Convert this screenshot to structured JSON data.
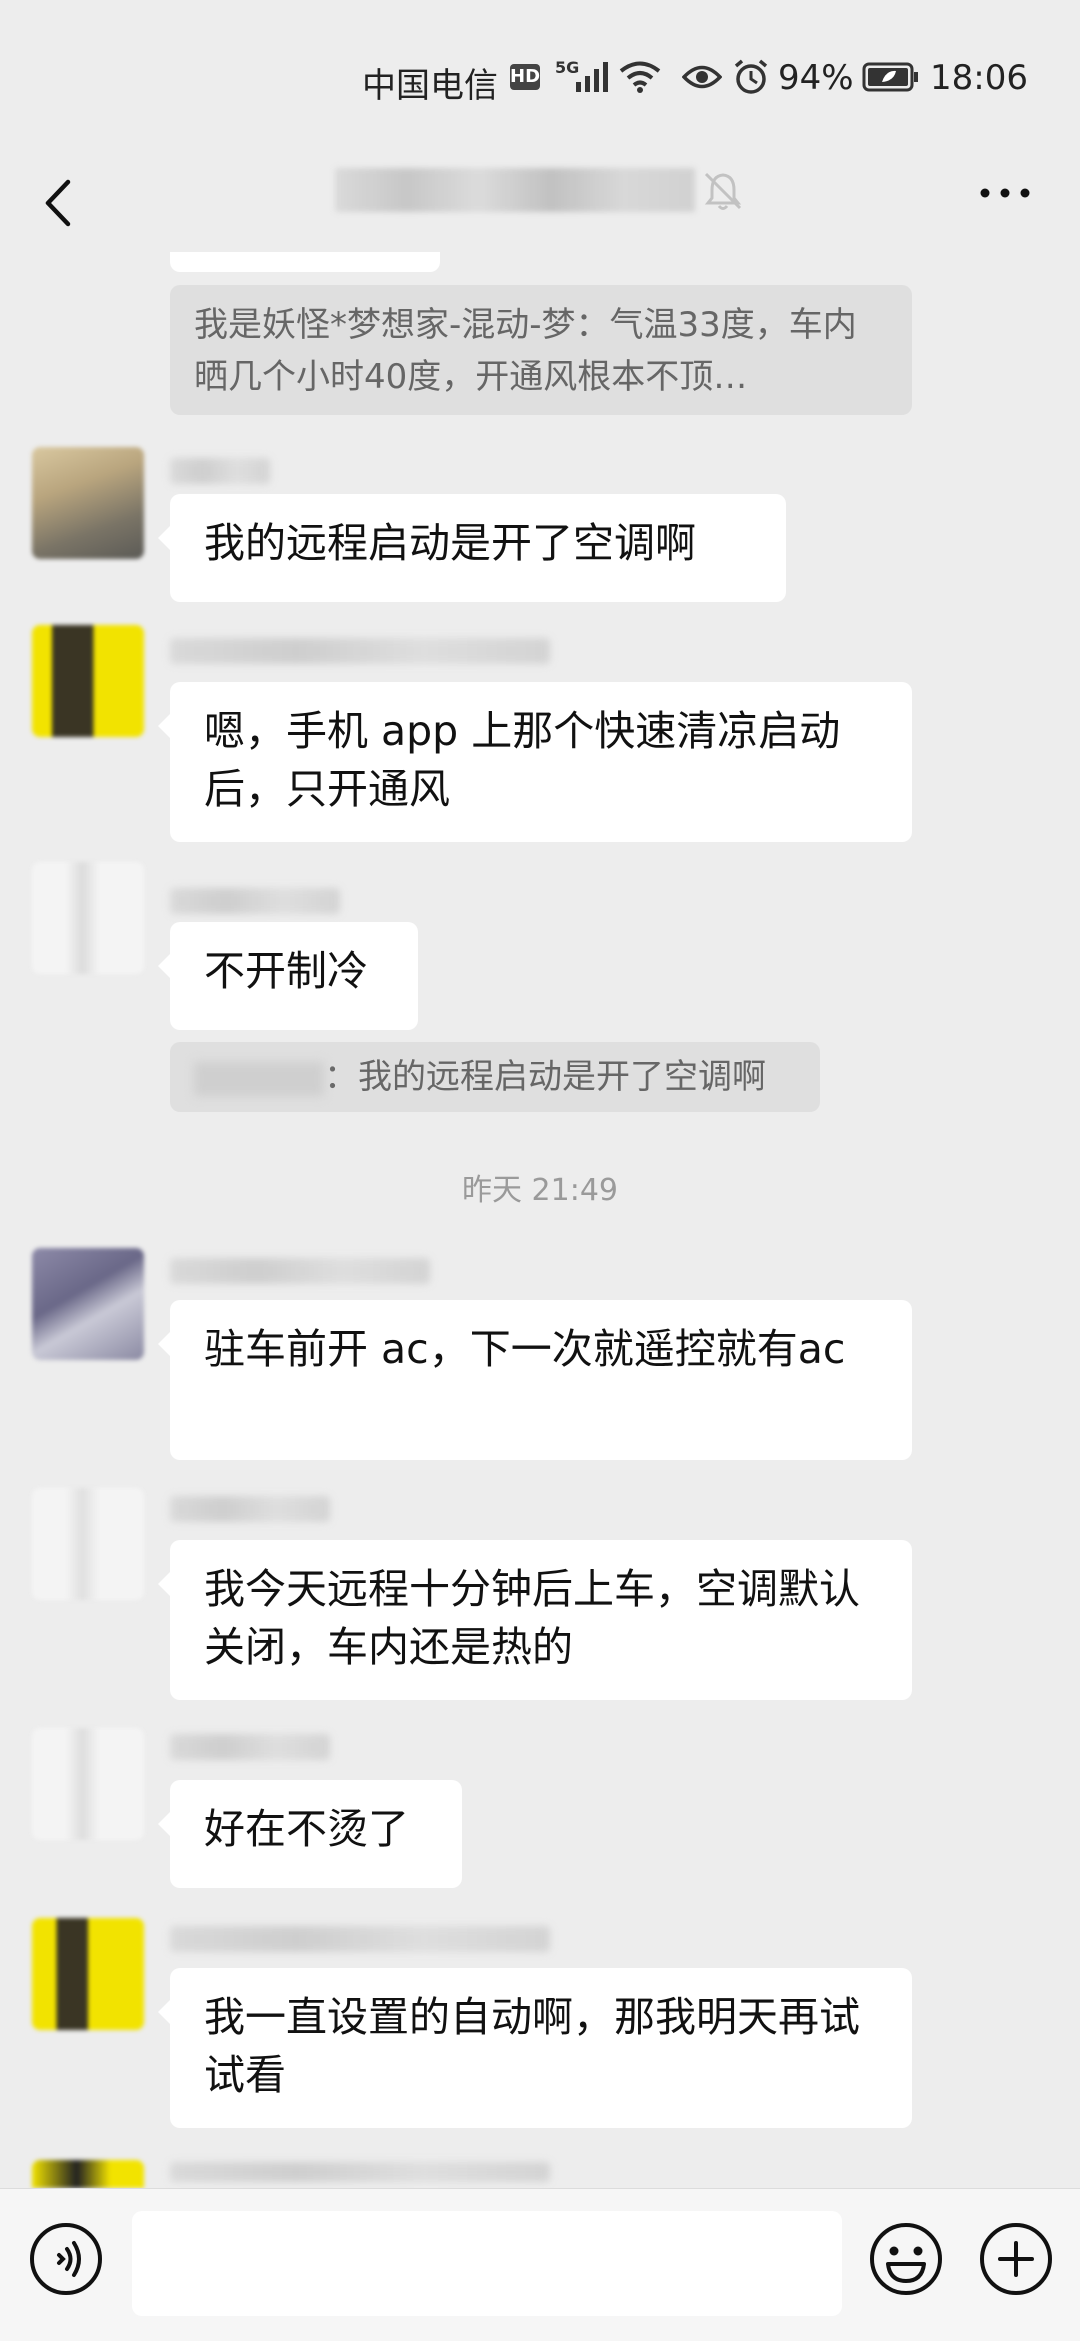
{
  "status_bar": {
    "carrier": "中国电信",
    "hd": "HD",
    "network": "5G",
    "battery": "94%",
    "time": "18:06"
  },
  "header": {
    "back_icon": "chevron-left-icon",
    "muted_icon": "bell-off-icon",
    "more_icon": "more-dots-icon"
  },
  "messages": [
    {
      "quote": "我是妖怪*梦想家-混动-梦：气温33度，车内晒几个小时40度，开通风根本不顶…"
    },
    {
      "text": "我的远程启动是开了空调啊"
    },
    {
      "text": "嗯，手机 app 上那个快速清凉启动后，只开通风"
    },
    {
      "text": "不开制冷",
      "quote": "：我的远程启动是开了空调啊"
    },
    {
      "timestamp": "昨天 21:49"
    },
    {
      "text": "驻车前开 ac，下一次就遥控就有ac"
    },
    {
      "text": "我今天远程十分钟后上车，空调默认关闭，车内还是热的"
    },
    {
      "text": "好在不烫了"
    },
    {
      "text": "我一直设置的自动啊，那我明天再试试看"
    }
  ],
  "input_bar": {
    "voice_icon": "voice-icon",
    "emoji_icon": "emoji-icon",
    "plus_icon": "plus-icon",
    "message_value": ""
  }
}
